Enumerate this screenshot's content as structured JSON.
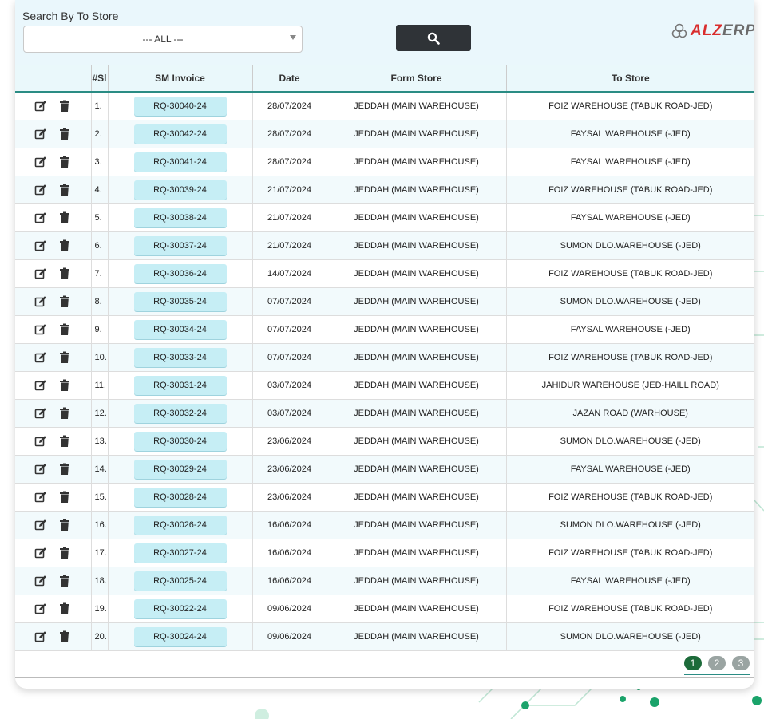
{
  "search": {
    "label": "Search By To Store",
    "selected": "--- ALL ---"
  },
  "logo": {
    "part1": "ALZ",
    "part2": "ERP"
  },
  "table": {
    "headers": [
      "",
      "#Sl",
      "SM Invoice",
      "Date",
      "Form Store",
      "To Store"
    ],
    "rows": [
      {
        "sl": "1.",
        "invoice": "RQ-30040-24",
        "date": "28/07/2024",
        "from": "JEDDAH (MAIN WAREHOUSE)",
        "to": "FOIZ WAREHOUSE (TABUK ROAD-JED)"
      },
      {
        "sl": "2.",
        "invoice": "RQ-30042-24",
        "date": "28/07/2024",
        "from": "JEDDAH (MAIN WAREHOUSE)",
        "to": "FAYSAL WAREHOUSE (-JED)"
      },
      {
        "sl": "3.",
        "invoice": "RQ-30041-24",
        "date": "28/07/2024",
        "from": "JEDDAH (MAIN WAREHOUSE)",
        "to": "FAYSAL WAREHOUSE (-JED)"
      },
      {
        "sl": "4.",
        "invoice": "RQ-30039-24",
        "date": "21/07/2024",
        "from": "JEDDAH (MAIN WAREHOUSE)",
        "to": "FOIZ WAREHOUSE (TABUK ROAD-JED)"
      },
      {
        "sl": "5.",
        "invoice": "RQ-30038-24",
        "date": "21/07/2024",
        "from": "JEDDAH (MAIN WAREHOUSE)",
        "to": "FAYSAL WAREHOUSE (-JED)"
      },
      {
        "sl": "6.",
        "invoice": "RQ-30037-24",
        "date": "21/07/2024",
        "from": "JEDDAH (MAIN WAREHOUSE)",
        "to": "SUMON DLO.WAREHOUSE (-JED)"
      },
      {
        "sl": "7.",
        "invoice": "RQ-30036-24",
        "date": "14/07/2024",
        "from": "JEDDAH (MAIN WAREHOUSE)",
        "to": "FOIZ WAREHOUSE (TABUK ROAD-JED)"
      },
      {
        "sl": "8.",
        "invoice": "RQ-30035-24",
        "date": "07/07/2024",
        "from": "JEDDAH (MAIN WAREHOUSE)",
        "to": "SUMON DLO.WAREHOUSE (-JED)"
      },
      {
        "sl": "9.",
        "invoice": "RQ-30034-24",
        "date": "07/07/2024",
        "from": "JEDDAH (MAIN WAREHOUSE)",
        "to": "FAYSAL WAREHOUSE (-JED)"
      },
      {
        "sl": "10.",
        "invoice": "RQ-30033-24",
        "date": "07/07/2024",
        "from": "JEDDAH (MAIN WAREHOUSE)",
        "to": "FOIZ WAREHOUSE (TABUK ROAD-JED)"
      },
      {
        "sl": "11.",
        "invoice": "RQ-30031-24",
        "date": "03/07/2024",
        "from": "JEDDAH (MAIN WAREHOUSE)",
        "to": "JAHIDUR WAREHOUSE (JED-HAILL ROAD)"
      },
      {
        "sl": "12.",
        "invoice": "RQ-30032-24",
        "date": "03/07/2024",
        "from": "JEDDAH (MAIN WAREHOUSE)",
        "to": "JAZAN ROAD (WARHOUSE)"
      },
      {
        "sl": "13.",
        "invoice": "RQ-30030-24",
        "date": "23/06/2024",
        "from": "JEDDAH (MAIN WAREHOUSE)",
        "to": "SUMON DLO.WAREHOUSE (-JED)"
      },
      {
        "sl": "14.",
        "invoice": "RQ-30029-24",
        "date": "23/06/2024",
        "from": "JEDDAH (MAIN WAREHOUSE)",
        "to": "FAYSAL WAREHOUSE (-JED)"
      },
      {
        "sl": "15.",
        "invoice": "RQ-30028-24",
        "date": "23/06/2024",
        "from": "JEDDAH (MAIN WAREHOUSE)",
        "to": "FOIZ WAREHOUSE (TABUK ROAD-JED)"
      },
      {
        "sl": "16.",
        "invoice": "RQ-30026-24",
        "date": "16/06/2024",
        "from": "JEDDAH (MAIN WAREHOUSE)",
        "to": "SUMON DLO.WAREHOUSE (-JED)"
      },
      {
        "sl": "17.",
        "invoice": "RQ-30027-24",
        "date": "16/06/2024",
        "from": "JEDDAH (MAIN WAREHOUSE)",
        "to": "FOIZ WAREHOUSE (TABUK ROAD-JED)"
      },
      {
        "sl": "18.",
        "invoice": "RQ-30025-24",
        "date": "16/06/2024",
        "from": "JEDDAH (MAIN WAREHOUSE)",
        "to": "FAYSAL WAREHOUSE (-JED)"
      },
      {
        "sl": "19.",
        "invoice": "RQ-30022-24",
        "date": "09/06/2024",
        "from": "JEDDAH (MAIN WAREHOUSE)",
        "to": "FOIZ WAREHOUSE (TABUK ROAD-JED)"
      },
      {
        "sl": "20.",
        "invoice": "RQ-30024-24",
        "date": "09/06/2024",
        "from": "JEDDAH (MAIN WAREHOUSE)",
        "to": "SUMON DLO.WAREHOUSE (-JED)"
      }
    ]
  },
  "pagination": {
    "pages": [
      "1",
      "2",
      "3"
    ],
    "active": "1"
  },
  "icons": {
    "edit": "edit-icon",
    "delete": "trash-icon",
    "search": "search-icon"
  },
  "colors": {
    "accent": "#2a8c84",
    "invoice_button": "#c6eef5",
    "search_button": "#2f3337",
    "page_active": "#1d6b3a"
  }
}
